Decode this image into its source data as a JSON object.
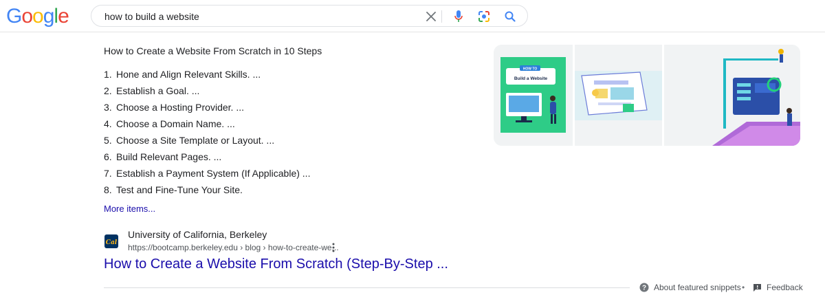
{
  "header": {
    "logo": [
      "G",
      "o",
      "o",
      "g",
      "l",
      "e"
    ],
    "logo_colors": [
      "#4285F4",
      "#EA4335",
      "#FBBC05",
      "#4285F4",
      "#34A853",
      "#EA4335"
    ],
    "search": {
      "query": "how to build a website"
    },
    "icons": {
      "clear": "close-icon",
      "mic": "mic-icon",
      "lens": "google-lens-icon",
      "search": "search-icon"
    }
  },
  "snippet": {
    "title": "How to Create a Website From Scratch in 10 Steps",
    "steps": [
      {
        "num": "1.",
        "text": "Hone and Align Relevant Skills. ..."
      },
      {
        "num": "2.",
        "text": "Establish a Goal. ..."
      },
      {
        "num": "3.",
        "text": "Choose a Hosting Provider. ..."
      },
      {
        "num": "4.",
        "text": "Choose a Domain Name. ..."
      },
      {
        "num": "5.",
        "text": "Choose a Site Template or Layout. ..."
      },
      {
        "num": "6.",
        "text": "Build Relevant Pages. ..."
      },
      {
        "num": "7.",
        "text": "Establish a Payment System (If Applicable) ..."
      },
      {
        "num": "8.",
        "text": "Test and Fine-Tune Your Site."
      }
    ],
    "more_items": "More items...",
    "images": {
      "tile1": {
        "badge": "HOW TO",
        "caption": "Build a Website"
      }
    }
  },
  "result": {
    "site_name": "University of California, Berkeley",
    "url": "https://bootcamp.berkeley.edu › blog › how-to-create-we...",
    "title": "How to Create a Website From Scratch (Step-By-Step ...",
    "favicon_text": "Cal"
  },
  "footer": {
    "about": "About featured snippets",
    "separator": "•",
    "feedback": "Feedback"
  },
  "colors": {
    "link": "#1a0dab",
    "text": "#202124",
    "muted": "#4d5156"
  }
}
